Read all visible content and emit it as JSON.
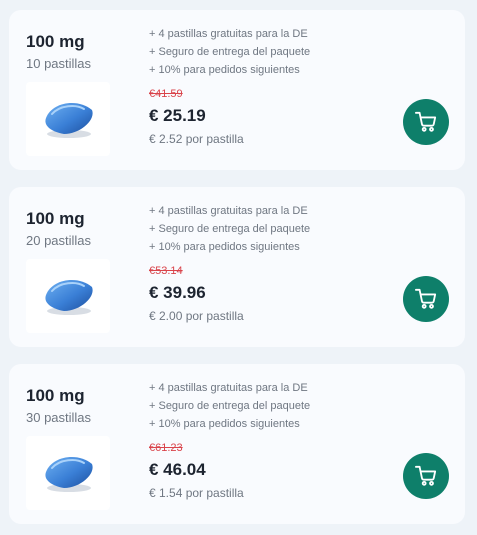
{
  "offers": [
    {
      "dose": "100 mg",
      "quantity": "10 pastillas",
      "bonuses": [
        "+ 4 pastillas gratuitas para la DE",
        "+ Seguro de entrega del paquete",
        "+ 10% para pedidos siguientes"
      ],
      "old_price": "€41.59",
      "price": "€ 25.19",
      "per_pill": "€ 2.52 por pastilla",
      "icons": {
        "pill": "blue-pill-icon",
        "cart": "cart-icon"
      }
    },
    {
      "dose": "100 mg",
      "quantity": "20 pastillas",
      "bonuses": [
        "+ 4 pastillas gratuitas para la DE",
        "+ Seguro de entrega del paquete",
        "+ 10% para pedidos siguientes"
      ],
      "old_price": "€53.14",
      "price": "€ 39.96",
      "per_pill": "€ 2.00 por pastilla",
      "icons": {
        "pill": "blue-pill-icon",
        "cart": "cart-icon"
      }
    },
    {
      "dose": "100 mg",
      "quantity": "30 pastillas",
      "bonuses": [
        "+ 4 pastillas gratuitas para la DE",
        "+ Seguro de entrega del paquete",
        "+ 10% para pedidos siguientes"
      ],
      "old_price": "€61.23",
      "price": "€ 46.04",
      "per_pill": "€ 1.54 por pastilla",
      "icons": {
        "pill": "blue-pill-icon",
        "cart": "cart-icon"
      }
    }
  ],
  "colors": {
    "page_background": "#eef3f8",
    "card_background": "#f9fbfe",
    "cart_button": "#0e7f6a",
    "old_price": "#d9434a",
    "pill": "#3a7fd6"
  }
}
